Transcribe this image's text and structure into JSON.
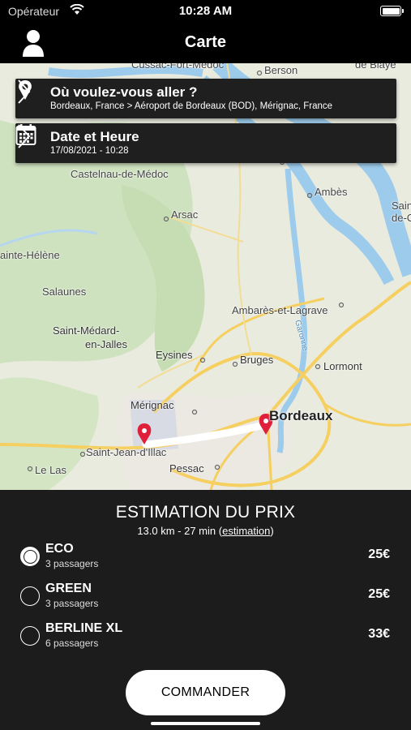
{
  "status_bar": {
    "carrier": "Opérateur",
    "time": "10:28 AM"
  },
  "nav": {
    "title": "Carte"
  },
  "destination": {
    "title": "Où voulez-vous aller ?",
    "subtitle": "Bordeaux, France > Aéroport de Bordeaux (BOD), Mérignac, France"
  },
  "date": {
    "title": "Date et Heure",
    "value": "17/08/2021 - 10:28"
  },
  "map": {
    "labels": {
      "cussac": "Cussac-Fort-Médoc",
      "berson": "Berson",
      "blaye": "de Blaye",
      "castelnau": "Castelnau-de-Médoc",
      "ambes": "Ambès",
      "saint_de": "Sain de-C",
      "arsac": "Arsac",
      "sainte_helene": "ainte-Hélène",
      "salaunes": "Salaunes",
      "ambares": "Ambarès-et-Lagrave",
      "garonne": "Garonne",
      "saint_medard": "Saint-Médard-",
      "en_jalles": "en-Jalles",
      "eysines": "Eysines",
      "bruges": "Bruges",
      "lormont": "Lormont",
      "merignac": "Mérignac",
      "bordeaux": "Bordeaux",
      "saint_jean": "Saint-Jean-d'Illac",
      "le_las": "Le Las",
      "pessac": "Pessac"
    }
  },
  "estimate": {
    "title": "ESTIMATION DU PRIX",
    "distance_time": "13.0 km - 27 min ",
    "open_paren": "(",
    "link": "estimation",
    "close_paren": ")"
  },
  "options": [
    {
      "name": "ECO",
      "passengers": "3 passagers",
      "price": "25€",
      "selected": true
    },
    {
      "name": "GREEN",
      "passengers": "3 passagers",
      "price": "25€",
      "selected": false
    },
    {
      "name": "BERLINE XL",
      "passengers": "6 passagers",
      "price": "33€",
      "selected": false
    }
  ],
  "order_button": {
    "label": "COMMANDER"
  },
  "colors": {
    "background": "#1c1c1c",
    "card": "#1f1f1f",
    "pin": "#e0203a",
    "water": "#9ccbec",
    "road": "#f6cf61",
    "forest": "#cfe2bf"
  },
  "icons": [
    "wifi-icon",
    "battery-icon",
    "profile-icon",
    "location-pin-icon",
    "calendar-icon",
    "chevron-right-icon",
    "map-pin-icon"
  ]
}
